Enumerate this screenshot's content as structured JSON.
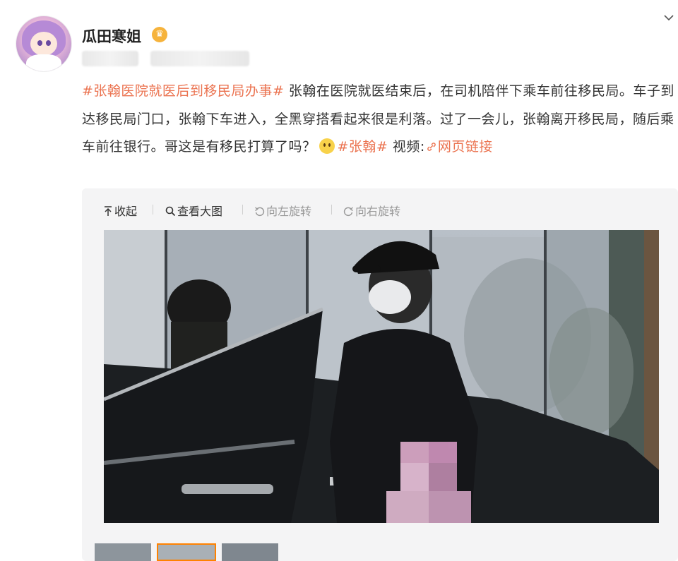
{
  "user": {
    "name": "瓜田寒姐",
    "avatar_icon": "anime-girl-avatar",
    "badge_icon": "vip-crown-icon"
  },
  "post": {
    "tag_main": "#张翰医院就医后到移民局办事#",
    "text_1": " 张翰在医院就医结束后，在司机陪伴下乘车前往移民局。车子到达移民局门口，张翰下车进入，全黑穿搭看起来很是利落。过了一会儿，张翰离开移民局，随后乘车前往银行。哥这是有移民打算了吗？",
    "tag_person": "#张翰#",
    "video_label": " 视频:",
    "link_label": "网页链接"
  },
  "toolbar": {
    "collapse": "收起",
    "view_large": "查看大图",
    "rotate_left": "向左旋转",
    "rotate_right": "向右旋转"
  },
  "colors": {
    "accent": "#eb7350",
    "active_thumb": "#ff8200"
  }
}
